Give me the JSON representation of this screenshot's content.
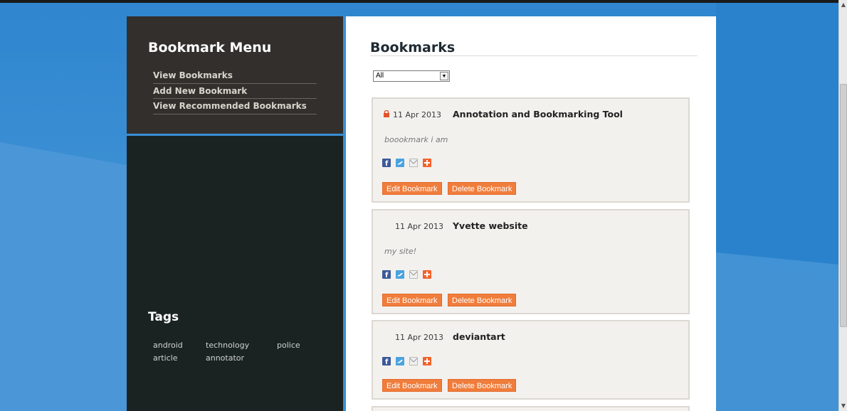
{
  "colors": {
    "background": "#3f8fd0",
    "menu_bg": "#332f2c",
    "tags_bg": "#1b2322",
    "button": "#f07d3c",
    "card_bg": "#f3f1ee"
  },
  "sidebar": {
    "menu_title": "Bookmark Menu",
    "menu_items": [
      {
        "label": "View Bookmarks"
      },
      {
        "label": "Add New Bookmark"
      },
      {
        "label": "View Recommended Bookmarks"
      }
    ],
    "tags_title": "Tags",
    "tags": [
      "android",
      "technology",
      "police",
      "article",
      "annotator"
    ]
  },
  "main": {
    "title": "Bookmarks",
    "filter": {
      "selected": "All"
    },
    "bookmarks": [
      {
        "date": "11 Apr 2013",
        "title": "Annotation and Bookmarking Tool",
        "description": "boookmark i am",
        "private": true,
        "icon": "lock-icon"
      },
      {
        "date": "11 Apr 2013",
        "title": "Yvette website",
        "description": "my site!",
        "private": false
      },
      {
        "date": "11 Apr 2013",
        "title": "deviantart",
        "description": "",
        "private": false
      }
    ],
    "share_icons": [
      "facebook-icon",
      "twitter-icon",
      "email-icon",
      "plus-icon"
    ],
    "edit_label": "Edit Bookmark",
    "delete_label": "Delete Bookmark"
  }
}
